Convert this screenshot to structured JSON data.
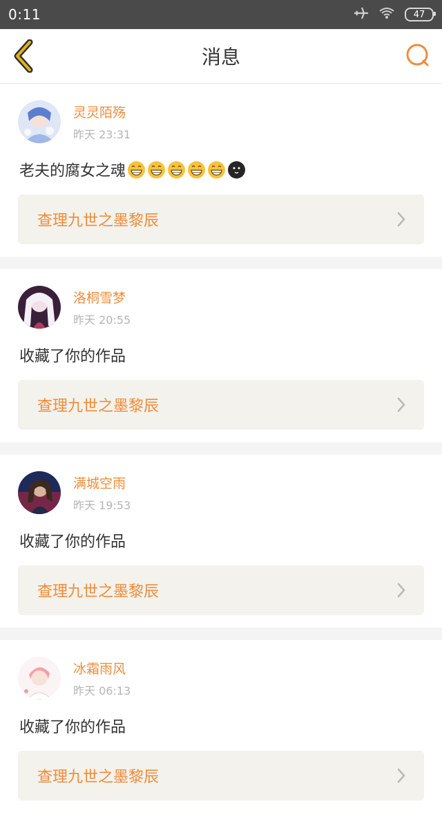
{
  "status_bar": {
    "time": "0:11",
    "battery": "47"
  },
  "nav": {
    "title": "消息"
  },
  "messages": [
    {
      "user": "灵灵陌殇",
      "time": "昨天 23:31",
      "text": "老夫的腐女之魂",
      "emojis": [
        "grin",
        "grin",
        "grin",
        "grin",
        "grin",
        "moon"
      ],
      "work_title": "查理九世之墨黎辰"
    },
    {
      "user": "洛桐雪梦",
      "time": "昨天 20:55",
      "text": "收藏了你的作品",
      "work_title": "查理九世之墨黎辰"
    },
    {
      "user": "满城空雨",
      "time": "昨天 19:53",
      "text": "收藏了你的作品",
      "work_title": "查理九世之墨黎辰"
    },
    {
      "user": "冰霜雨风",
      "time": "昨天 06:13",
      "text": "收藏了你的作品",
      "work_title": "查理九世之墨黎辰"
    }
  ],
  "colors": {
    "accent": "#ef8c3b",
    "back_icon": "#e2b318"
  }
}
